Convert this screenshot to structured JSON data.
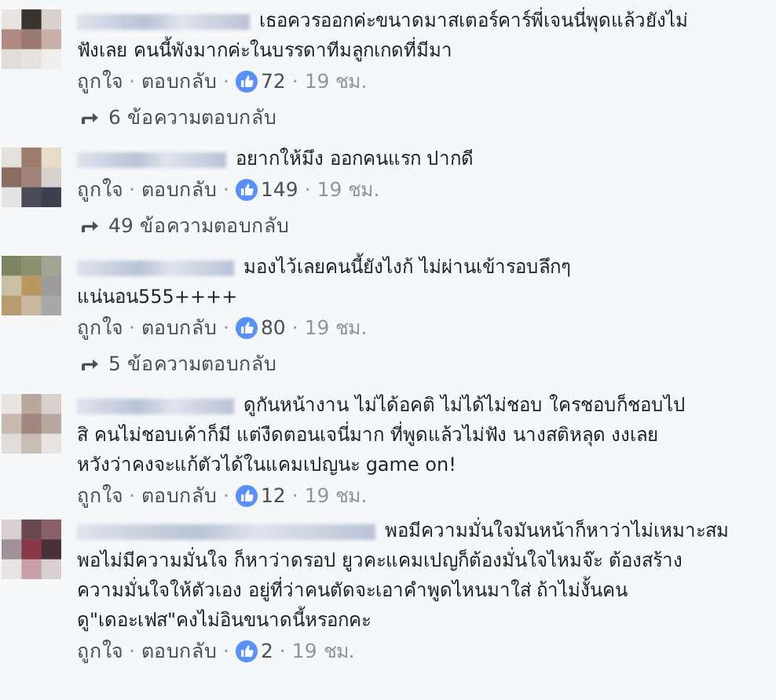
{
  "separator": "·",
  "comments": [
    {
      "lines": [
        "เธอควรออกค่ะขนาดมาสเตอร์คาร์พี่เจนนี่พุดแล้วยังไม่",
        "ฟังเลย คนนี้พังมากค่ะในบรรดาทีมลูกเกดที่มีมา"
      ],
      "like_label": "ถูกใจ",
      "reply_label": "ตอบกลับ",
      "likes": "72",
      "time": "19 ชม.",
      "replies": "6 ข้อความตอบกลับ"
    },
    {
      "lines": [
        "อยากให้มึง ออกคนแรก ปากดี"
      ],
      "like_label": "ถูกใจ",
      "reply_label": "ตอบกลับ",
      "likes": "149",
      "time": "19 ชม.",
      "replies": "49 ข้อความตอบกลับ"
    },
    {
      "lines": [
        "มองไว้เลยคนนี้ยังไงก้ ไม่ผ่านเข้ารอบลึกๆ",
        "แน่นอน555++++"
      ],
      "like_label": "ถูกใจ",
      "reply_label": "ตอบกลับ",
      "likes": "80",
      "time": "19 ชม.",
      "replies": "5 ข้อความตอบกลับ"
    },
    {
      "lines": [
        "ดูกันหน้างาน ไม่ได้อคติ ไม่ได้ไม่ชอบ ใครชอบก็ชอบไป",
        "สิ คนไม่ชอบเค้าก็มี แต่งืดตอนเจนี่มาก ที่พูดแล้วไม่ฟัง นางสติหลุด งงเลย",
        "หวังว่าคงจะแก้ตัวได้ในแคมเปญนะ game on!"
      ],
      "like_label": "ถูกใจ",
      "reply_label": "ตอบกลับ",
      "likes": "12",
      "time": "19 ชม."
    },
    {
      "lines": [
        "พอมีความมั่นใจมันหน้าก็หาว่าไม่เหมาะสม",
        "พอไม่มีความมั่นใจ ก็หาว่าดรอป ยูวคะแคมเปญก็ต้องมั่นใจไหมจ๊ะ ต้องสร้าง",
        "ความมั่นใจให้ตัวเอง อยู่ที่ว่าคนตัดจะเอาคำพูดไหนมาใส่ ถ้าไม่งั้นคน",
        "ดู\"เดอะเฟส\"คงไม่อินขนาดนี้หรอกคะ"
      ],
      "like_label": "ถูกใจ",
      "reply_label": "ตอบกลับ",
      "likes": "2",
      "time": "19 ชม."
    }
  ]
}
